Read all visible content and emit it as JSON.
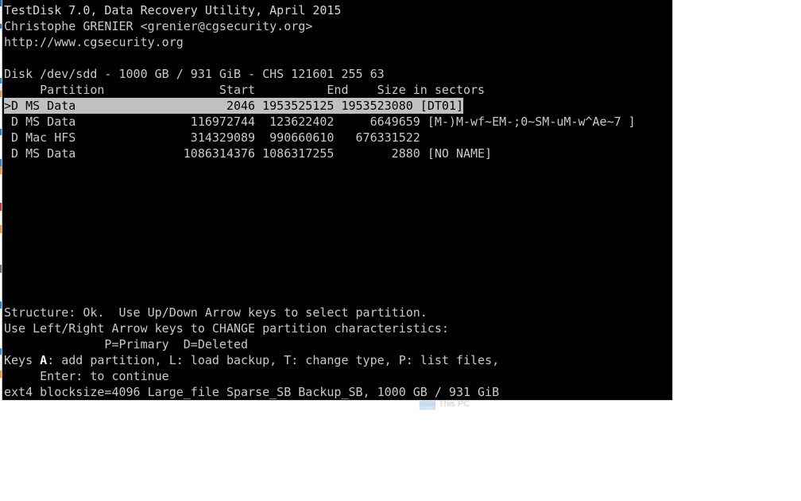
{
  "window": {
    "app_title": "TestDisk 7.0, Data Recovery Utility, April 2015",
    "author_line": "Christophe GRENIER <grenier@cgsecurity.org>",
    "url_line": "http://www.cgsecurity.org"
  },
  "disk": {
    "info_line": "Disk /dev/sdd - 1000 GB / 931 GiB - CHS 121601 255 63",
    "device": "/dev/sdd",
    "size_gb": "1000 GB",
    "size_gib": "931 GiB",
    "chs": "CHS 121601 255 63"
  },
  "table": {
    "header": "     Partition                Start          End    Size in sectors",
    "columns": [
      "Partition",
      "Start",
      "End",
      "Size in sectors"
    ],
    "rows": [
      {
        "marker": ">",
        "status": "D",
        "type": "MS Data",
        "start": "2046",
        "end": "1953525125",
        "size_in_sectors": "1953523080",
        "label": "[DT01]",
        "selected": true,
        "text": ">D MS Data                     2046 1953525125 1953523080 [DT01]",
        "overflow": ""
      },
      {
        "marker": " ",
        "status": "D",
        "type": "MS Data",
        "start": "116972744",
        "end": "123622402",
        "size_in_sectors": "6649659",
        "label": "[M-)M-wf~EM-;0~SM-uM-w^Ae~7 ]",
        "selected": false,
        "text": " D MS Data                116972744  123622402     6649659 [M-)M-wf~EM-;",
        "overflow": "0~SM-uM-w^Ae~7 ]"
      },
      {
        "marker": " ",
        "status": "D",
        "type": "Mac HFS",
        "start": "314329089",
        "end": "990660610",
        "size_in_sectors": "676331522",
        "label": "",
        "selected": false,
        "text": " D Mac HFS                314329089  990660610   676331522",
        "overflow": ""
      },
      {
        "marker": " ",
        "status": "D",
        "type": "MS Data",
        "start": "1086314376",
        "end": "1086317255",
        "size_in_sectors": "2880",
        "label": "[NO NAME]",
        "selected": false,
        "text": " D MS Data               1086314376 1086317255        2880 [NO NAME]",
        "overflow": ""
      }
    ]
  },
  "status": {
    "structure_line": "Structure: Ok.  Use Up/Down Arrow keys to select partition.",
    "change_line": "Use Left/Right Arrow keys to CHANGE partition characteristics:",
    "legend_line": "              P=Primary  D=Deleted",
    "keys_prefix": "Keys ",
    "keys_hotkey": "A",
    "keys_rest": ": add partition, L: load backup, T: change type, P: list files,",
    "enter_line": "     Enter: to continue",
    "fs_line": "ext4 blocksize=4096 Large_file Sparse_SB Backup_SB, 1000 GB / 931 GiB"
  },
  "desktop": {
    "icon_label": "This PC",
    "icon_name": "this-pc-icon"
  },
  "colors": {
    "terminal_background": "#000000",
    "terminal_foreground": "#c9c9c9",
    "selection_background": "#c0c0c0",
    "selection_foreground": "#000000",
    "window_border": "#d9d9d9",
    "page_background": "#ffffff"
  }
}
